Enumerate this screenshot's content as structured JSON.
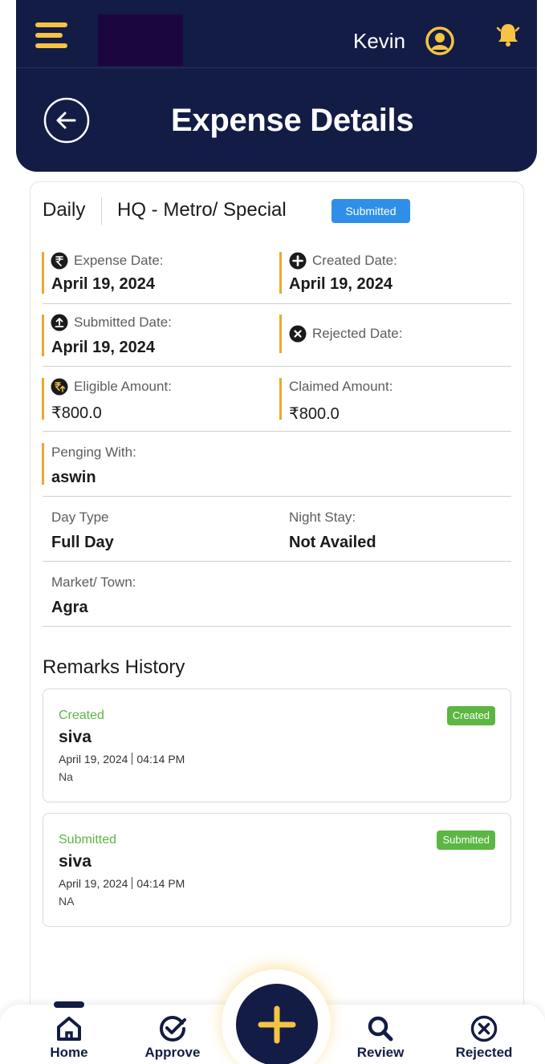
{
  "header": {
    "username": "Kevin",
    "title": "Expense Details",
    "icons": {
      "menu": "hamburger-icon",
      "user": "user-circle-icon",
      "bell": "bell-icon",
      "back": "back-arrow-icon"
    }
  },
  "summary": {
    "frequency": "Daily",
    "category": "HQ - Metro/ Special",
    "status": "Submitted"
  },
  "fields": {
    "expense_date": {
      "label": "Expense Date:",
      "value": "April 19, 2024",
      "icon": "rupee-icon"
    },
    "created_date": {
      "label": "Created Date:",
      "value": "April 19, 2024",
      "icon": "plus-circle-icon"
    },
    "submitted_date": {
      "label": "Submitted Date:",
      "value": "April 19, 2024",
      "icon": "upload-circle-icon"
    },
    "rejected_date": {
      "label": "Rejected Date:",
      "value": "",
      "icon": "x-circle-icon"
    },
    "eligible_amount": {
      "label": "Eligible Amount:",
      "value": "₹800.0",
      "icon": "money-icon"
    },
    "claimed_amount": {
      "label": "Claimed Amount:",
      "value": "₹800.0"
    },
    "pending_with": {
      "label": "Penging With:",
      "value": "aswin"
    },
    "day_type": {
      "label": "Day Type",
      "value": "Full Day"
    },
    "night_stay": {
      "label": "Night Stay:",
      "value": "Not Availed"
    },
    "market_town": {
      "label": "Market/ Town:",
      "value": "Agra"
    }
  },
  "remarks": {
    "title": "Remarks History",
    "items": [
      {
        "status": "Created",
        "name": "siva",
        "date": "April 19, 2024",
        "time": "04:14 PM",
        "note": "Na",
        "badge": "Created"
      },
      {
        "status": "Submitted",
        "name": "siva",
        "date": "April 19, 2024",
        "time": "04:14 PM",
        "note": "NA",
        "badge": "Submitted"
      }
    ]
  },
  "nav": {
    "items": [
      {
        "label": "Home",
        "icon": "home-icon"
      },
      {
        "label": "Approve",
        "icon": "check-badge-icon"
      },
      {
        "label": "",
        "icon": "plus-icon"
      },
      {
        "label": "Review",
        "icon": "search-icon"
      },
      {
        "label": "Rejected",
        "icon": "x-circle-icon"
      }
    ]
  },
  "colors": {
    "navy": "#131c45",
    "accent": "#f6c343",
    "blue_badge": "#2f8fe8",
    "green": "#5bb642",
    "orange_bar": "#f1a72b"
  }
}
